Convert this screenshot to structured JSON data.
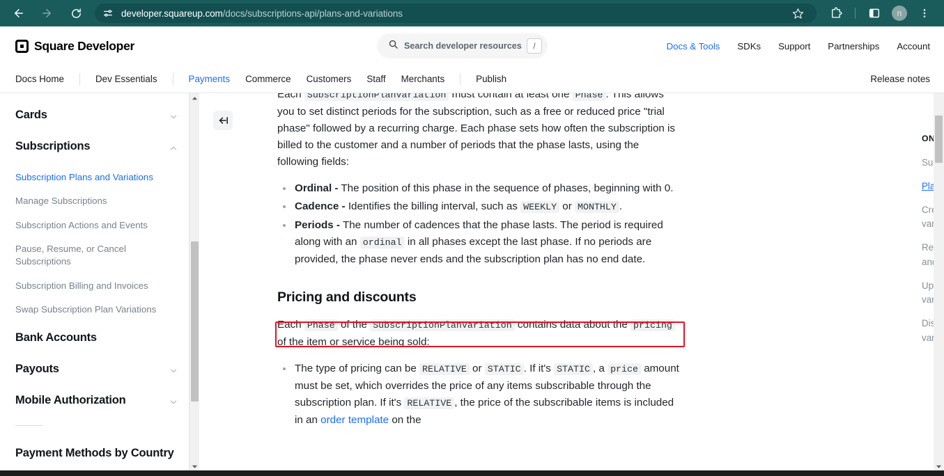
{
  "browser": {
    "back_icon": "back-arrow-icon",
    "forward_icon": "forward-arrow-icon",
    "reload_icon": "reload-icon",
    "site_settings_icon": "site-settings-icon",
    "url_domain": "developer.squareup.com",
    "url_path": "/docs/subscriptions-api/plans-and-variations",
    "bookmark_icon": "star-icon",
    "extensions_icon": "extensions-puzzle-icon",
    "side_panel_icon": "side-panel-icon",
    "profile_initial": "n",
    "menu_icon": "three-dot-menu-icon",
    "chrome_bg": "#1a5c5c"
  },
  "header": {
    "brand": "Square Developer",
    "search": {
      "placeholder": "Search developer resources",
      "shortcut": "/",
      "icon": "search-icon"
    },
    "links": [
      {
        "label": "Docs & Tools",
        "active": true
      },
      {
        "label": "SDKs",
        "active": false
      },
      {
        "label": "Support",
        "active": false
      },
      {
        "label": "Partnerships",
        "active": false
      },
      {
        "label": "Account",
        "active": false
      }
    ]
  },
  "subnav": {
    "items": [
      {
        "label": "Docs Home",
        "active": false,
        "sep_after": true
      },
      {
        "label": "Dev Essentials",
        "active": false,
        "sep_after": true
      },
      {
        "label": "Payments",
        "active": true,
        "sep_after": false
      },
      {
        "label": "Commerce",
        "active": false,
        "sep_after": false
      },
      {
        "label": "Customers",
        "active": false,
        "sep_after": false
      },
      {
        "label": "Staff",
        "active": false,
        "sep_after": false
      },
      {
        "label": "Merchants",
        "active": false,
        "sep_after": true
      },
      {
        "label": "Publish",
        "active": false,
        "sep_after": false
      }
    ],
    "release_notes": "Release notes"
  },
  "sidebar": {
    "groups": [
      {
        "title": "Cards",
        "chevron": "chevron-down-icon"
      },
      {
        "title": "Subscriptions",
        "chevron": "chevron-up-icon"
      }
    ],
    "subscription_links": [
      {
        "label": "Subscription Plans and Variations",
        "active": true
      },
      {
        "label": "Manage Subscriptions",
        "active": false
      },
      {
        "label": "Subscription Actions and Events",
        "active": false
      },
      {
        "label": "Pause, Resume, or Cancel Subscriptions",
        "active": false
      },
      {
        "label": "Subscription Billing and Invoices",
        "active": false
      },
      {
        "label": "Swap Subscription Plan Variations",
        "active": false
      }
    ],
    "more_groups": [
      {
        "title": "Bank Accounts",
        "chevron": ""
      },
      {
        "title": "Payouts",
        "chevron": "chevron-down-icon"
      },
      {
        "title": "Mobile Authorization",
        "chevron": "chevron-down-icon"
      }
    ],
    "footer_group": {
      "title": "Payment Methods by Country"
    }
  },
  "main": {
    "collapse_icon": "collapse-sidebar-icon",
    "intro": {
      "l1a": "Each ",
      "code1": "SubscriptionPlanVariation",
      "l1b": " must contain at least one ",
      "code2": "Phase",
      "l1c": ". This allows you to set distinct periods for the subscription, such as a free or reduced price \"trial phase\" followed by a recurring charge. Each phase sets how often the subscription is billed to the customer and a number of periods that the phase lasts, using the following fields:"
    },
    "fields": [
      {
        "term": "Ordinal -",
        "text": " The position of this phase in the sequence of phases, beginning with 0.",
        "highlighted": false
      },
      {
        "term": "Cadence -",
        "text_a": " Identifies the billing interval, such as ",
        "code_a": "WEEKLY",
        "text_b": " or ",
        "code_b": "MONTHLY",
        "text_c": ".",
        "highlighted": true
      },
      {
        "term": "Periods -",
        "text_a": " The number of cadences that the phase lasts. The period is required along with an ",
        "code_a": "ordinal",
        "text_b": " in all phases except the last phase. If no periods are provided, the phase never ends and the subscription plan has no end date.",
        "highlighted": false
      }
    ],
    "section_heading": "Pricing and discounts",
    "pricing_intro": {
      "a": "Each ",
      "code1": "Phase",
      "b": " of the ",
      "code2": "SubscriptionPlanVariation",
      "c": " contains data about the ",
      "code3": "pricing",
      "d": " of the item or service being sold:"
    },
    "pricing_bullet": {
      "a": "The type of pricing can be ",
      "code1": "RELATIVE",
      "b": " or ",
      "code2": "STATIC",
      "c": ". If it's ",
      "code3": "STATIC",
      "d": ", a ",
      "code4": "price",
      "e": " amount must be set, which overrides the price of any items subscribable through the subscription plan. If it's ",
      "code5": "RELATIVE",
      "f": ", the price of the subscribable items is included in an ",
      "link": "order template",
      "g": " on the"
    },
    "highlight_color": "#e81123"
  },
  "toc": {
    "title": "ON THIS PAGE",
    "items": [
      {
        "label": "Subscription plans",
        "active": false
      },
      {
        "label": "Plan variations",
        "active": true
      },
      {
        "label": "Create a subscription plan variation",
        "active": false
      },
      {
        "label": "Retrieve subscription plans and variations",
        "active": false
      },
      {
        "label": "Update subscription plans and variations",
        "active": false
      },
      {
        "label": "Disable subscription plans and variations",
        "active": false
      }
    ]
  }
}
